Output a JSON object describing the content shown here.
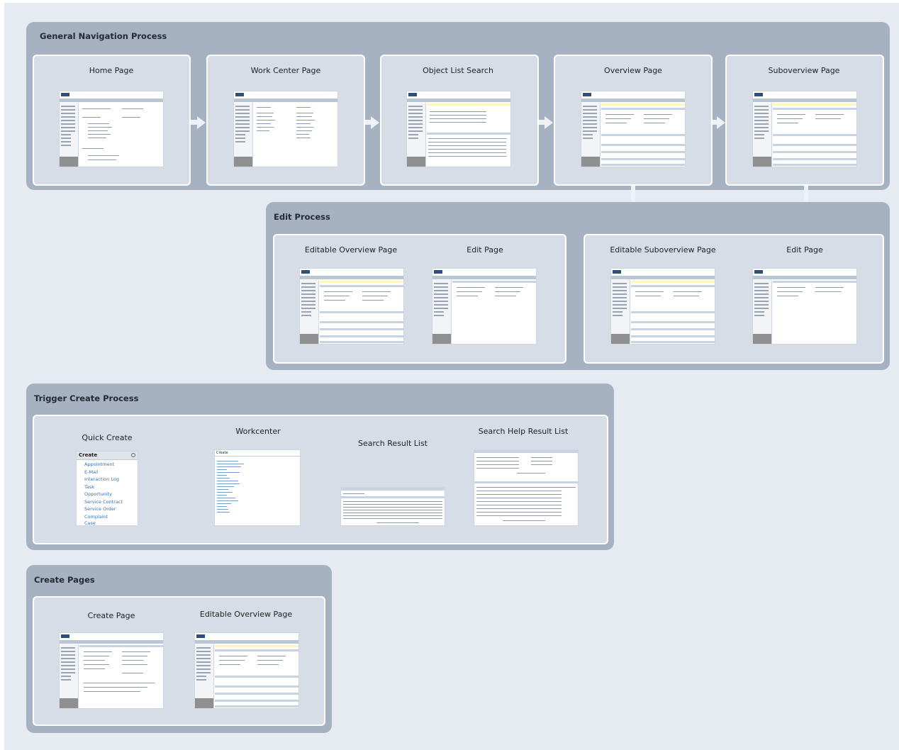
{
  "groups": {
    "general": {
      "title": "General Navigation Process"
    },
    "edit": {
      "title": "Edit Process"
    },
    "trigger": {
      "title": "Trigger Create Process"
    },
    "create": {
      "title": "Create Pages"
    }
  },
  "general_pages": [
    "Home Page",
    "Work Center Page",
    "Object List Search",
    "Overview Page",
    "Suboverview Page"
  ],
  "edit_pages": [
    "Editable Overview Page",
    "Edit Page",
    "Editable Suboverview Page",
    "Edit Page"
  ],
  "trigger_items": {
    "quick_create": "Quick Create",
    "workcenter": "Workcenter",
    "search_result": "Search Result List",
    "search_help": "Search Help Result List"
  },
  "quick_create_box": {
    "header": "Create",
    "items": [
      "Appointment",
      "E-Mail",
      "Interaction Log",
      "Task",
      "Opportunity",
      "Service Contract",
      "Service Order",
      "Complaint",
      "Case"
    ]
  },
  "workcenter_box": {
    "header": "Create"
  },
  "create_pages": [
    "Create Page",
    "Editable Overview Page"
  ],
  "colors": {
    "background": "#e6ebf1",
    "group": "#a6b2c1",
    "panel": "#d6dde6",
    "arrow": "#eef1f5"
  }
}
